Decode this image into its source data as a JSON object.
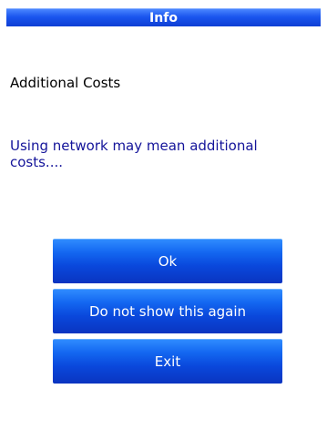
{
  "dialog": {
    "title": "Info",
    "heading": "Additional Costs",
    "message": "Using network may mean additional costs....",
    "buttons": {
      "ok": "Ok",
      "do_not_show": "Do not show this again",
      "exit": "Exit"
    }
  },
  "colors": {
    "title_bar": "#1a55ee",
    "button": "#1366f0",
    "message_text": "#14149a"
  }
}
